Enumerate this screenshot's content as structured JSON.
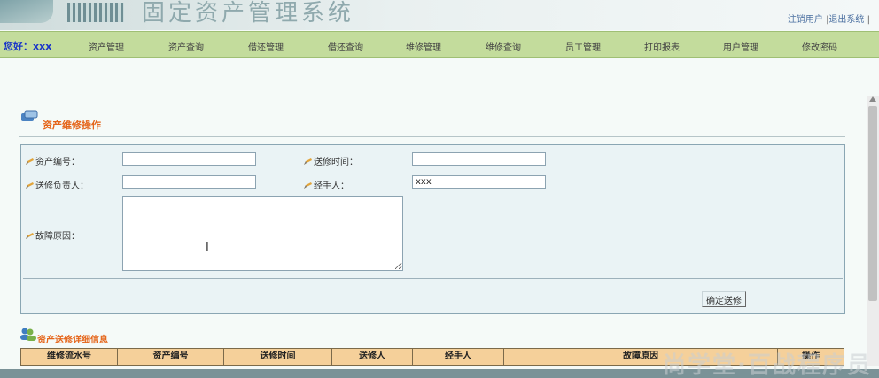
{
  "header": {
    "title": "固定资产管理系统",
    "links": {
      "logout_user": "注销用户",
      "exit_system": "退出系统",
      "sep": "|"
    }
  },
  "nav": {
    "greeting": "您好：xxx",
    "items": [
      "资产管理",
      "资产查询",
      "借还管理",
      "借还查询",
      "维修管理",
      "维修查询",
      "员工管理",
      "打印报表",
      "用户管理",
      "修改密码"
    ]
  },
  "section": {
    "title": "资产维修操作"
  },
  "form": {
    "asset_no_label": "资产编号：",
    "asset_no_value": "",
    "send_time_label": "送修时间：",
    "send_time_value": "",
    "responsible_label": "送修负责人：",
    "responsible_value": "",
    "handler_label": "经手人：",
    "handler_value": "xxx",
    "fault_label": "故障原因：",
    "fault_value": "",
    "confirm_button": "确定送修"
  },
  "details": {
    "title": "资产送修详细信息",
    "columns": [
      "维修流水号",
      "资产编号",
      "送修时间",
      "送修人",
      "经手人",
      "故障原因",
      "操作"
    ]
  },
  "watermark": "尚学堂·百战程序员",
  "colors": {
    "nav_bg": "#c3dc9c",
    "accent": "#e5651a",
    "greet": "#1a35c8",
    "table_header": "#f5d09a"
  }
}
